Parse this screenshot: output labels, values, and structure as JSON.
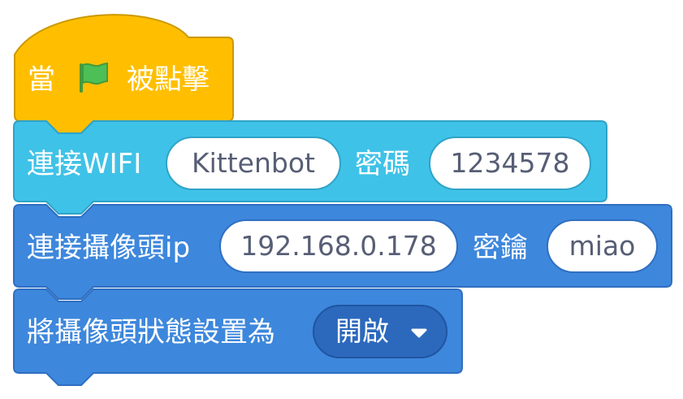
{
  "colors": {
    "event_fill": "#ffbf00",
    "event_border": "#cc9900",
    "wifi_fill": "#3fc2e8",
    "wifi_border": "#2fa3c7",
    "camera_fill": "#3d87dc",
    "camera_border": "#2f6fc1",
    "dropdown_fill": "#2c69bd",
    "input_text": "#575e75",
    "flag_green": "#4cbf56",
    "flag_dark": "#45993d"
  },
  "hat_block": {
    "prefix": "當",
    "icon": "green-flag-icon",
    "suffix": "被點擊"
  },
  "wifi_block": {
    "label": "連接WIFI",
    "ssid": "Kittenbot",
    "password_label": "密碼",
    "password": "1234578"
  },
  "camera_ip_block": {
    "label": "連接攝像頭ip",
    "ip": "192.168.0.178",
    "key_label": "密鑰",
    "key": "miao"
  },
  "camera_state_block": {
    "label": "將攝像頭狀態設置為",
    "state": "開啟",
    "dropdown_icon": "caret-down-icon"
  }
}
